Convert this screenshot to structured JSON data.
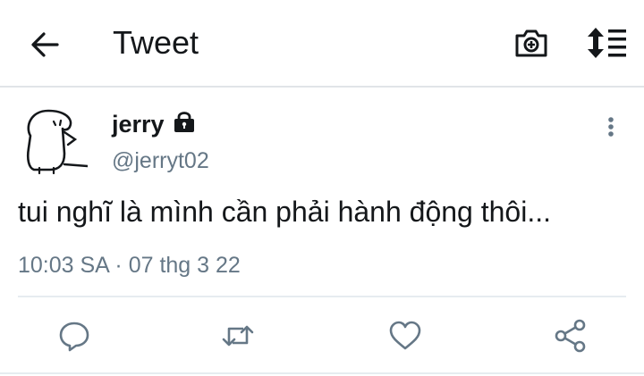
{
  "header": {
    "title": "Tweet",
    "icons": {
      "back": "arrow-left-icon",
      "camera": "camera-add-icon",
      "sort": "sort-list-icon"
    }
  },
  "tweet": {
    "display_name": "jerry",
    "handle": "@jerryt02",
    "protected_icon": "lock-icon",
    "text": "tui nghĩ là mình cần phải hành động thôi...",
    "timestamp": "10:03 SA · 07 thg 3 22"
  },
  "actions": {
    "reply": "reply-icon",
    "retweet": "retweet-icon",
    "like": "heart-icon",
    "share": "share-icon"
  },
  "colors": {
    "text_primary": "#14171a",
    "text_secondary": "#657786",
    "divider": "#e6ecf0",
    "icon": "#657786"
  }
}
